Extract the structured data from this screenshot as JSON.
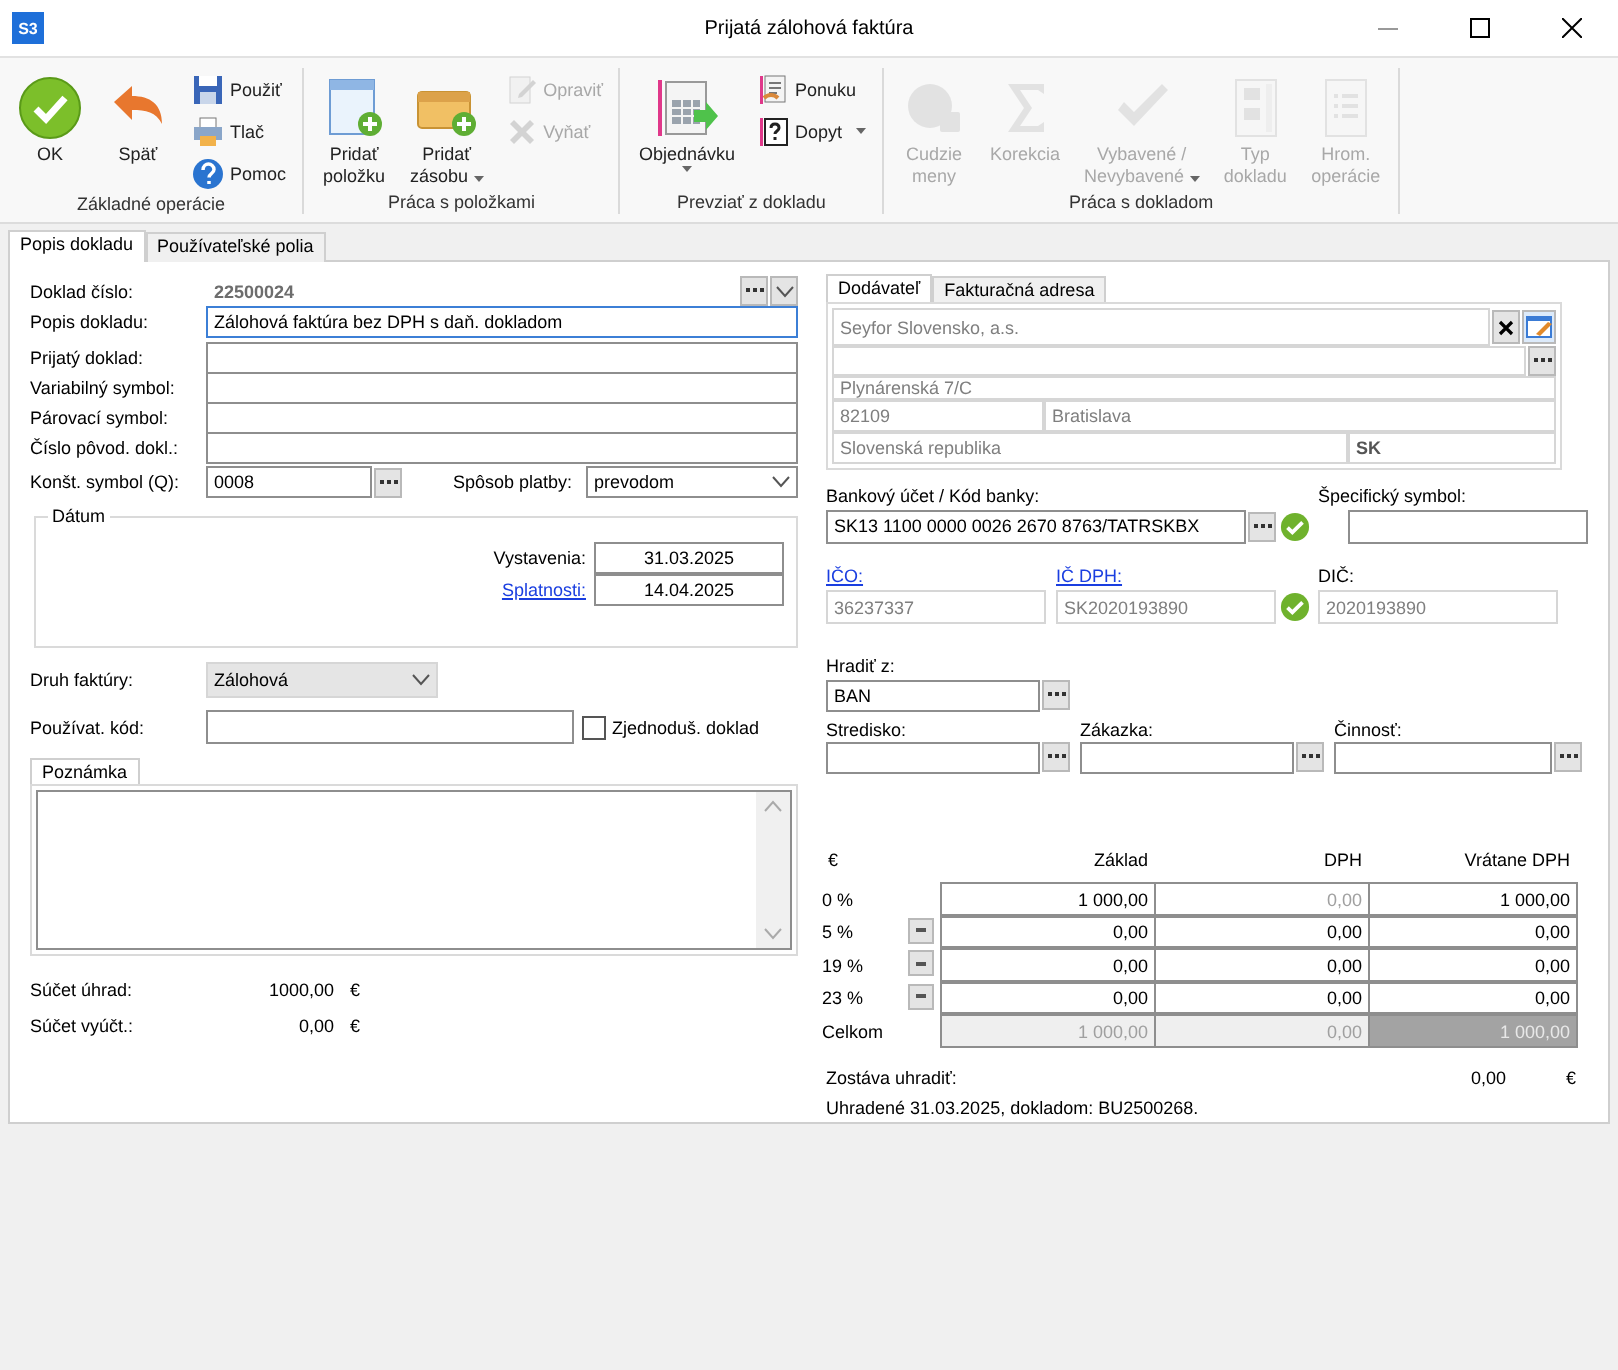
{
  "window": {
    "title": "Prijatá zálohová faktúra",
    "app_badge": "S3"
  },
  "ribbon_groups": [
    {
      "label": "Základné operácie",
      "items": [
        {
          "kind": "large",
          "lines": [
            "OK"
          ],
          "disabled": false,
          "dropdown": false
        },
        {
          "kind": "large",
          "lines": [
            "Späť"
          ],
          "disabled": false,
          "dropdown": false
        },
        {
          "kind": "stack",
          "items": [
            {
              "label": "Použiť",
              "disabled": false,
              "dropdown": false
            },
            {
              "label": "Tlač",
              "disabled": false,
              "dropdown": false
            },
            {
              "label": "Pomoc",
              "disabled": false,
              "dropdown": false
            }
          ]
        }
      ]
    },
    {
      "label": "Práca s položkami",
      "items": [
        {
          "kind": "large",
          "lines": [
            "Pridať",
            "položku"
          ],
          "disabled": false,
          "dropdown": false
        },
        {
          "kind": "large",
          "lines": [
            "Pridať",
            "zásobu"
          ],
          "disabled": false,
          "dropdown": true
        },
        {
          "kind": "stack",
          "items": [
            {
              "label": "Opraviť",
              "disabled": true,
              "dropdown": false
            },
            {
              "label": "Vyňať",
              "disabled": true,
              "dropdown": false
            }
          ]
        }
      ]
    },
    {
      "label": "Prevziať z dokladu",
      "items": [
        {
          "kind": "large",
          "lines": [
            "Objednávku"
          ],
          "disabled": false,
          "dropdown": true
        },
        {
          "kind": "stack",
          "items": [
            {
              "label": "Ponuku",
              "disabled": false,
              "dropdown": false
            },
            {
              "label": "Dopyt",
              "disabled": false,
              "dropdown": true
            }
          ]
        }
      ]
    },
    {
      "label": "Práca s dokladom",
      "items": [
        {
          "kind": "large",
          "lines": [
            "Cudzie",
            "meny"
          ],
          "disabled": true,
          "dropdown": false
        },
        {
          "kind": "large",
          "lines": [
            "Korekcia"
          ],
          "disabled": true,
          "dropdown": false
        },
        {
          "kind": "large",
          "lines": [
            "Vybavené /",
            "Nevybavené"
          ],
          "disabled": true,
          "dropdown": true
        },
        {
          "kind": "large",
          "lines": [
            "Typ",
            "dokladu"
          ],
          "disabled": true,
          "dropdown": false
        },
        {
          "kind": "large",
          "lines": [
            "Hrom.",
            "operácie"
          ],
          "disabled": true,
          "dropdown": false
        }
      ]
    }
  ],
  "document_tabs": [
    {
      "label": "Popis dokladu",
      "selected": true
    },
    {
      "label": "Používateľské polia",
      "selected": false
    }
  ],
  "header_fields": [
    {
      "kind": "doc_number",
      "label": "Doklad číslo:",
      "value": "22500024",
      "focused": false
    },
    {
      "kind": "text",
      "label": "Popis dokladu:",
      "value": "Zálohová faktúra bez DPH s daň. dokladom",
      "focused": true
    },
    {
      "kind": "text",
      "label": "Prijatý doklad:",
      "focused": false
    },
    {
      "kind": "text",
      "label": "Variabilný symbol:",
      "focused": false
    },
    {
      "kind": "text",
      "label": "Párovací symbol:",
      "focused": false
    },
    {
      "kind": "text",
      "label": "Číslo pôvod. dokl.:",
      "focused": false
    }
  ],
  "constant_symbol": {
    "label": "Konšt. symbol (Q):",
    "value": "0008"
  },
  "payment_method": {
    "label": "Spôsob platby:",
    "value": "prevodom"
  },
  "dates": {
    "title": "Dátum",
    "rows": [
      {
        "kind": "plain",
        "label": "Vystavenia:",
        "value": "31.03.2025"
      },
      {
        "kind": "link",
        "label": "Splatnosti:",
        "value": "14.04.2025"
      }
    ]
  },
  "invoice_type": {
    "label": "Druh faktúry:",
    "value": "Zálohová"
  },
  "user_code": {
    "label": "Používat. kód:"
  },
  "simplified": {
    "label": "Zjednoduš. doklad",
    "checked": false
  },
  "note": {
    "tab": "Poznámka"
  },
  "sums": [
    {
      "label": "Súčet úhrad:",
      "value": "1000,00",
      "currency": "€"
    },
    {
      "label": "Súčet vyúčt.:",
      "value": "0,00",
      "currency": "€"
    }
  ],
  "partner_tabs": [
    {
      "label": "Dodávateľ",
      "selected": true
    },
    {
      "label": "Fakturačná adresa",
      "selected": false
    }
  ],
  "supplier": {
    "name": "Seyfor Slovensko, a.s.",
    "street": "Plynárenská 7/C",
    "zip": "82109",
    "city": "Bratislava",
    "country": "Slovenská republika",
    "country_code": "SK"
  },
  "bank_account": {
    "label": "Bankový účet / Kód banky:",
    "value": "SK13 1100 0000 0026 2670 8763/TATRSKBX",
    "verified": true
  },
  "specific_symbol": {
    "label": "Špecifický symbol:"
  },
  "ids": [
    {
      "kind": "link",
      "label": "IČO:",
      "value": "36237337",
      "verified": false
    },
    {
      "kind": "link",
      "label": "IČ DPH:",
      "value": "SK2020193890",
      "verified": true
    },
    {
      "kind": "plain",
      "label": "DIČ:",
      "value": "2020193890",
      "verified": false
    }
  ],
  "pay_from": {
    "label": "Hradiť z:",
    "value": "BAN"
  },
  "lookups": [
    {
      "label": "Stredisko:"
    },
    {
      "label": "Zákazka:"
    },
    {
      "label": "Činnosť:"
    }
  ],
  "vat_table": {
    "currency_header": "€",
    "columns": [
      "Základ",
      "DPH",
      "Vrátane DPH"
    ],
    "rows": [
      {
        "rate": "0 %",
        "menu": false,
        "cells": [
          {
            "value": "1 000,00",
            "disabled": false
          },
          {
            "value": "0,00",
            "disabled": true
          },
          {
            "value": "1 000,00",
            "disabled": false
          }
        ]
      },
      {
        "rate": "5 %",
        "menu": true,
        "cells": [
          {
            "value": "0,00",
            "disabled": false
          },
          {
            "value": "0,00",
            "disabled": false
          },
          {
            "value": "0,00",
            "disabled": false
          }
        ]
      },
      {
        "rate": "19 %",
        "menu": true,
        "cells": [
          {
            "value": "0,00",
            "disabled": false
          },
          {
            "value": "0,00",
            "disabled": false
          },
          {
            "value": "0,00",
            "disabled": false
          }
        ]
      },
      {
        "rate": "23 %",
        "menu": true,
        "cells": [
          {
            "value": "0,00",
            "disabled": false
          },
          {
            "value": "0,00",
            "disabled": false
          },
          {
            "value": "0,00",
            "disabled": false
          }
        ]
      }
    ],
    "total": {
      "label": "Celkom",
      "cells": [
        "1 000,00",
        "0,00",
        "1 000,00"
      ]
    }
  },
  "remaining": {
    "label": "Zostáva uhradiť:",
    "value": "0,00",
    "currency": "€"
  },
  "paid_note": "Uhradené 31.03.2025, dokladom: BU2500268."
}
